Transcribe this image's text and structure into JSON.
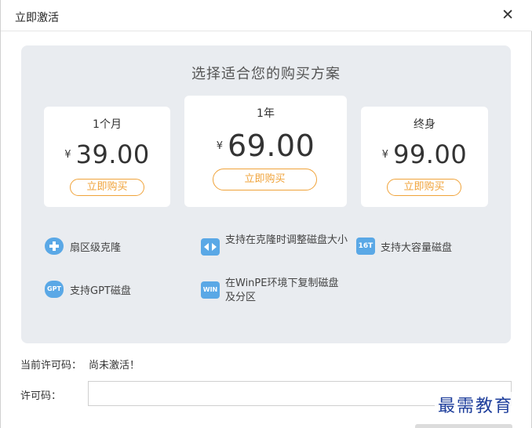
{
  "window": {
    "title": "立即激活",
    "close_glyph": "✕"
  },
  "headline": "选择适合您的购买方案",
  "plans": [
    {
      "name": "1个月",
      "currency": "¥",
      "price": "39.00",
      "button": "立即购买"
    },
    {
      "name": "1年",
      "currency": "¥",
      "price": "69.00",
      "button": "立即购买"
    },
    {
      "name": "终身",
      "currency": "¥",
      "price": "99.00",
      "button": "立即购买"
    }
  ],
  "features": [
    {
      "icon": "sector-clone-icon",
      "text": "扇区级克隆"
    },
    {
      "icon": "resize-disk-icon",
      "text": "支持在克隆时调整磁盘大小"
    },
    {
      "icon": "large-disk-icon",
      "text": "支持大容量磁盘",
      "badge": "16T"
    },
    {
      "icon": "gpt-disk-icon",
      "text": "支持GPT磁盘",
      "badge": "GPT"
    },
    {
      "icon": "winpe-icon",
      "text": "在WinPE环境下复制磁盘及分区",
      "badge": "WIN"
    }
  ],
  "license": {
    "status_label": "当前许可码：",
    "status_value": "尚未激活！",
    "code_label": "许可码：",
    "code_value": ""
  },
  "watermark": "最需教育",
  "colors": {
    "accent": "#f0a33a",
    "panel": "#e9ecf0",
    "icon": "#5aa8e6",
    "watermark": "#1f3f9c"
  }
}
